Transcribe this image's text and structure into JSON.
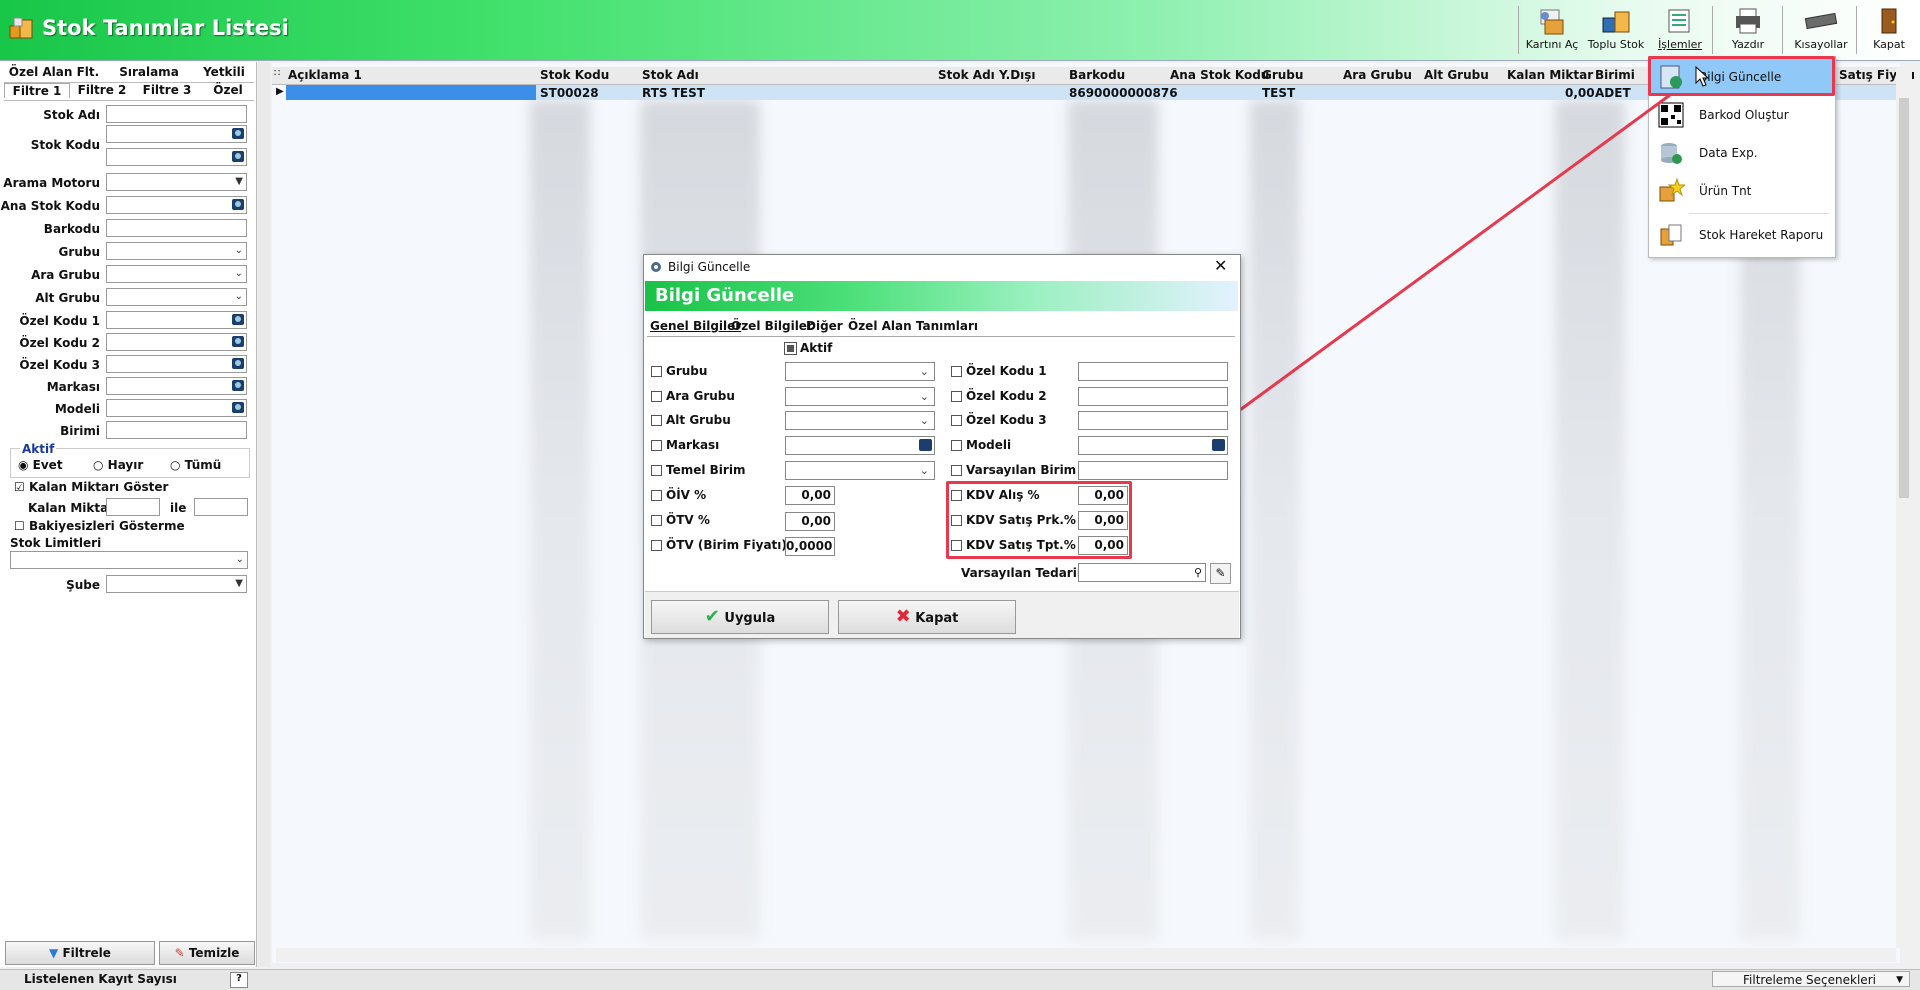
{
  "app": {
    "title": "Stok Tanımlar Listesi"
  },
  "toolbar": [
    {
      "name": "kartini-ac",
      "label": "Kartını Aç"
    },
    {
      "name": "toplu-stok",
      "label": "Toplu Stok"
    },
    {
      "name": "islemler",
      "label": "İşlemler"
    },
    {
      "name": "yazdir",
      "label": "Yazdır"
    },
    {
      "name": "kisayollar",
      "label": "Kısayollar"
    },
    {
      "name": "kapat",
      "label": "Kapat"
    }
  ],
  "filter": {
    "tabs_row1": [
      "Özel Alan Flt.",
      "Sıralama",
      "Yetkili"
    ],
    "tabs_row2": [
      "Filtre 1",
      "Filtre 2",
      "Filtre 3",
      "Özel"
    ],
    "fields": {
      "stok_adi": "Stok Adı",
      "stok_kodu": "Stok Kodu",
      "arama_motoru": "Arama Motoru",
      "ana_stok_kodu": "Ana Stok Kodu",
      "barkodu": "Barkodu",
      "grubu": "Grubu",
      "ara_grubu": "Ara Grubu",
      "alt_grubu": "Alt Grubu",
      "ozel_kodu_1": "Özel Kodu 1",
      "ozel_kodu_2": "Özel Kodu 2",
      "ozel_kodu_3": "Özel Kodu 3",
      "markasi": "Markası",
      "modeli": "Modeli",
      "birimi": "Birimi"
    },
    "aktif": {
      "title": "Aktif",
      "options": [
        "Evet",
        "Hayır",
        "Tümü"
      ],
      "selected": "Evet"
    },
    "kalan_miktari_goster": "Kalan Miktarı Göster",
    "kalan_miktar": "Kalan Miktar",
    "ile": "ile",
    "bakiyesizleri_gosterme": "Bakiyesizleri Gösterme",
    "stok_limitleri": "Stok Limitleri",
    "sube": "Şube",
    "filtrele": "Filtrele",
    "temizle": "Temizle"
  },
  "grid": {
    "columns": [
      "Açıklama 1",
      "Stok Kodu",
      "Stok Adı",
      "Stok Adı Y.Dışı",
      "Barkodu",
      "Ana Stok Kodu",
      "Grubu",
      "Ara Grubu",
      "Alt Grubu",
      "Kalan Miktar",
      "Birimi",
      "Satış Fiyatı"
    ],
    "row": {
      "stok_kodu": "ST00028",
      "stok_adi": "RTS TEST",
      "barkodu": "8690000000876",
      "grubu": "TEST",
      "kalan_miktar": "0,00",
      "birimi": "ADET"
    }
  },
  "menu": [
    {
      "name": "bilgi-guncelle",
      "label": "Bilgi Güncelle"
    },
    {
      "name": "barkod-olustur",
      "label": "Barkod Oluştur"
    },
    {
      "name": "data-exp",
      "label": "Data Exp."
    },
    {
      "name": "urun-tnt",
      "label": "Ürün Tnt"
    },
    {
      "name": "stok-hareket-raporu",
      "label": "Stok Hareket Raporu"
    }
  ],
  "dialog": {
    "window_title": "Bilgi Güncelle",
    "header": "Bilgi Güncelle",
    "tabs": [
      "Genel Bilgiler",
      "Özel Bilgiler",
      "Diğer",
      "Özel Alan Tanımları"
    ],
    "aktif": "Aktif",
    "left_labels": [
      "Grubu",
      "Ara Grubu",
      "Alt Grubu",
      "Markası",
      "Temel Birim",
      "ÖİV %",
      "ÖTV %",
      "ÖTV (Birim Fiyatı)"
    ],
    "oiv_value": "0,00",
    "otv_value": "0,00",
    "otv_birim_value": "0,0000",
    "right_labels": [
      "Özel Kodu 1",
      "Özel Kodu 2",
      "Özel Kodu 3",
      "Modeli",
      "Varsayılan Birim",
      "KDV Alış %",
      "KDV Satış Prk.%",
      "KDV Satış Tpt.%"
    ],
    "kdv_alis": "0,00",
    "kdv_satis_prk": "0,00",
    "kdv_satis_tpt": "0,00",
    "varsayilan_tedarikci": "Varsayılan Tedarikçi",
    "uygula": "Uygula",
    "kapat": "Kapat"
  },
  "status": {
    "left": "Listelenen Kayıt Sayısı",
    "help": "?",
    "right": "Filtreleme Seçenekleri"
  },
  "colors": {
    "accent_green": "#19c247",
    "highlight_red": "#e8384e",
    "selection": "#cfe3f7"
  }
}
